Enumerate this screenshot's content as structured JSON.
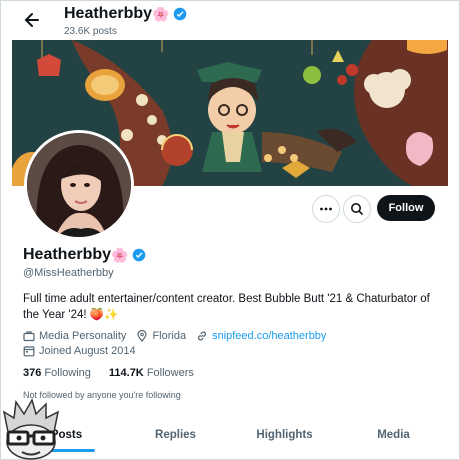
{
  "topbar": {
    "name": "Heatherbby",
    "name_emoji": "🌸",
    "posts": "23.6K posts"
  },
  "profile": {
    "name": "Heatherbby",
    "name_emoji": "🌸",
    "handle": "@MissHeatherbby",
    "bio": "Full time adult entertainer/content creator. Best Bubble Butt '21 & Chaturbator of the Year '24! 🍑✨",
    "category": "Media Personality",
    "location": "Florida",
    "link": "snipfeed.co/heatherbby",
    "joined": "Joined August 2014",
    "following_count": "376",
    "following_label": "Following",
    "followers_count": "114.7K",
    "followers_label": "Followers",
    "not_followed": "Not followed by anyone you're following"
  },
  "actions": {
    "follow_label": "Follow"
  },
  "tabs": [
    {
      "label": "Posts"
    },
    {
      "label": "Replies"
    },
    {
      "label": "Highlights"
    },
    {
      "label": "Media"
    }
  ],
  "colors": {
    "accent": "#1d9bf0",
    "text": "#0f1419",
    "muted": "#536471",
    "banner_bg": "#1f3a3e"
  },
  "icons": [
    "back-arrow-icon",
    "verified-badge-icon",
    "more-icon",
    "search-icon",
    "briefcase-icon",
    "location-pin-icon",
    "link-icon",
    "calendar-icon"
  ]
}
